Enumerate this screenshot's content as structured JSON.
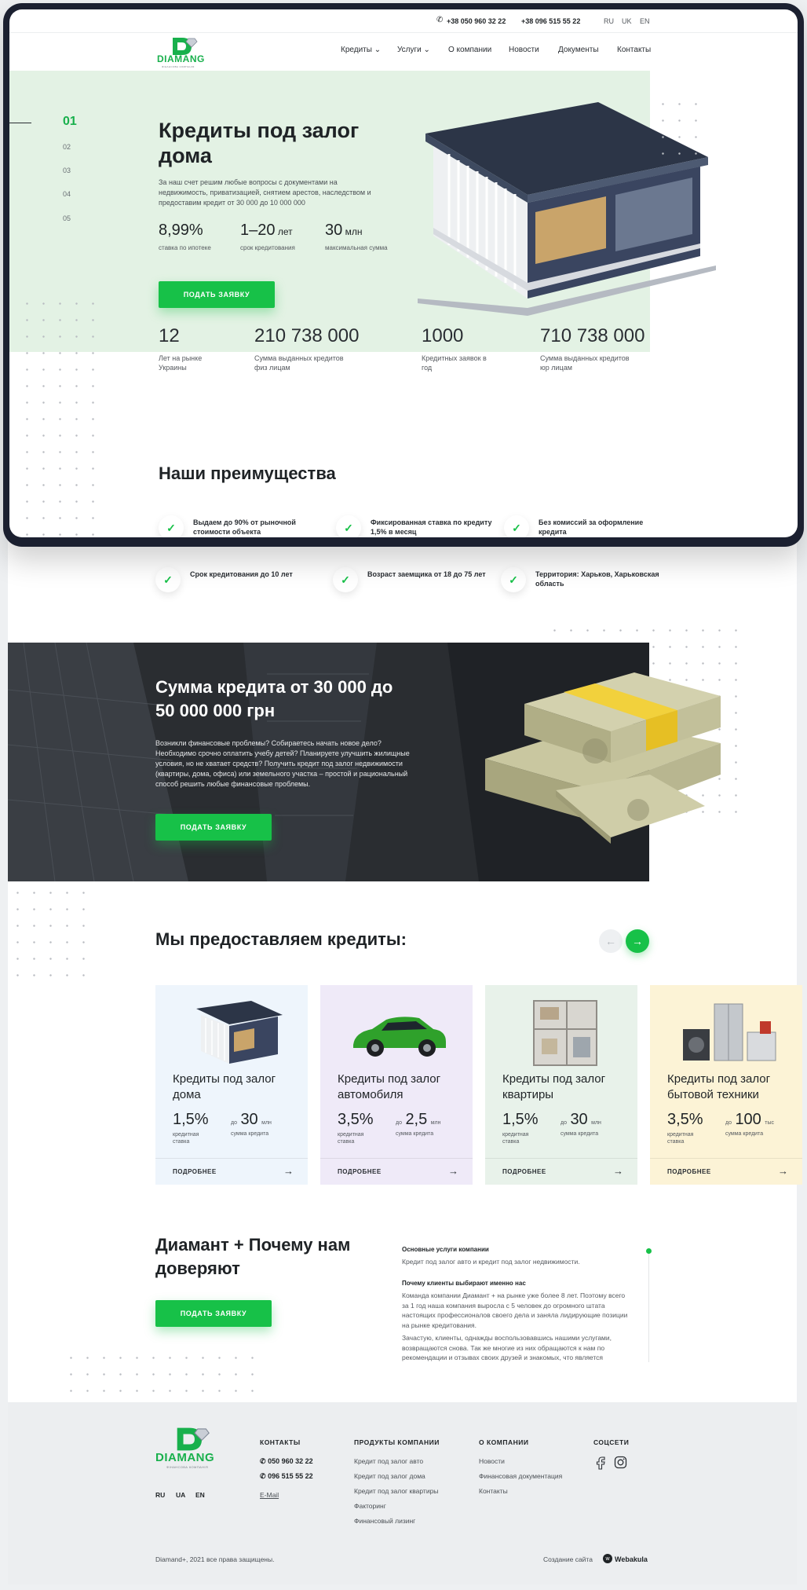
{
  "topbar": {
    "phone1": "+38 050 960 32 22",
    "phone2": "+38 096 515 55 22",
    "langs": [
      "RU",
      "UK",
      "EN"
    ]
  },
  "logo": {
    "word": "DIAMANG",
    "sub": "ФІНАНСОВА КОМПАНІЯ"
  },
  "nav": [
    "Кредиты",
    "Услуги",
    "О компании",
    "Новости",
    "Документы",
    "Контакты"
  ],
  "hero": {
    "slides": [
      "01",
      "02",
      "03",
      "04",
      "05"
    ],
    "title": "Кредиты под залог дома",
    "description": "За наш счет решим любые вопросы с документами на недвижимость, приватизацией, снятием арестов, наследством и предоставим кредит от 30 000 до 10 000 000",
    "stats": [
      {
        "value": "8,99%",
        "unit": "",
        "label": "ставка по ипотеке"
      },
      {
        "value": "1–20",
        "unit": " лет",
        "label": "срок кредитования"
      },
      {
        "value": "30",
        "unit": " млн",
        "label": "максимальная сумма"
      }
    ],
    "button": "ПОДАТЬ ЗАЯВКУ"
  },
  "big_stats": [
    {
      "value": "12",
      "label": "Лет на рынке Украины"
    },
    {
      "value": "210 738 000",
      "label": "Сумма выданных кредитов физ лицам"
    },
    {
      "value": "1000",
      "label": "Кредитных заявок в год"
    },
    {
      "value": "710 738 000",
      "label": "Сумма выданных кредитов юр лицам"
    }
  ],
  "advantages": {
    "title": "Наши преимущества",
    "items": [
      "Выдаем до 90% от рыночной стоимости объекта",
      "Фиксированная ставка по кредиту 1,5% в месяц",
      "Без комиссий за оформление кредита",
      "Срок кредитования до 10 лет",
      "Возраст заемщика от 18 до 75 лет",
      "Территория: Харьков, Харьковская область"
    ]
  },
  "banner": {
    "title": "Сумма кредита от 30 000 до 50 000 000 грн",
    "description": "Возникли финансовые проблемы? Собираетесь начать новое дело? Необходимо срочно оплатить учебу детей? Планируете улучшить жилищные условия, но не хватает средств? Получить кредит под залог недвижимости (квартиры, дома, офиса) или земельного участка – простой и рациональный способ решить любые финансовые проблемы.",
    "button": "ПОДАТЬ ЗАЯВКУ"
  },
  "products": {
    "title": "Мы предоставляем кредиты:",
    "cards": [
      {
        "title": "Кредиты под залог дома",
        "rate": "1,5%",
        "rate_label": "кредитная ставка",
        "sum_prefix": "до",
        "sum": "30",
        "sum_unit": "млн",
        "sum_label": "сумма кредита",
        "more": "ПОДРОБНЕЕ",
        "bg": "#eef5fc"
      },
      {
        "title": "Кредиты под залог автомобиля",
        "rate": "3,5%",
        "rate_label": "кредитная ставка",
        "sum_prefix": "до",
        "sum": "2,5",
        "sum_unit": "млн",
        "sum_label": "сумма кредита",
        "more": "ПОДРОБНЕЕ",
        "bg": "#efeaf8"
      },
      {
        "title": "Кредиты под залог квартиры",
        "rate": "1,5%",
        "rate_label": "кредитная ставка",
        "sum_prefix": "до",
        "sum": "30",
        "sum_unit": "млн",
        "sum_label": "сумма кредита",
        "more": "ПОДРОБНЕЕ",
        "bg": "#e8f2ea"
      },
      {
        "title": "Кредиты под залог бытовой техники",
        "rate": "3,5%",
        "rate_label": "кредитная ставка",
        "sum_prefix": "до",
        "sum": "100",
        "sum_unit": "тыс",
        "sum_label": "сумма кредита",
        "more": "ПОДРОБНЕЕ",
        "bg": "#fcf3d6"
      }
    ]
  },
  "about": {
    "title": "Диамант + Почему нам доверяют",
    "button": "ПОДАТЬ ЗАЯВКУ",
    "h1": "Основные услуги компании",
    "p1": "Кредит под залог авто и кредит под залог недвижимости.",
    "h2": "Почему клиенты выбирают именно нас",
    "p2": "Команда компании Диамант + на рынке уже более 8 лет. Поэтому всего за 1 год наша компания выросла с 5 человек до огромного штата настоящих профессионалов своего дела и заняла лидирующие позиции на рынке кредитования.",
    "p3": "Зачастую, клиенты, однажды воспользовавшись нашими услугами, возвращаются снова. Так же многие из них обращаются к нам по рекомендации и отзывах своих друзей и знакомых, что является"
  },
  "footer": {
    "langs": [
      "RU",
      "UA",
      "EN"
    ],
    "contacts_h": "КОНТАКТЫ",
    "phones": [
      "050 960 32 22",
      "096 515 55 22"
    ],
    "email": "E-Mail",
    "products_h": "ПРОДУКТЫ КОМПАНИИ",
    "products": [
      "Кредит под залог авто",
      "Кредит под залог дома",
      "Кредит под залог квартиры",
      "Факторинг",
      "Финансовый лизинг"
    ],
    "about_h": "О КОМПАНИИ",
    "about": [
      "Новости",
      "Финансовая документация",
      "Контакты"
    ],
    "social_h": "СОЦСЕТИ",
    "copyright": "Diamand+, 2021 все права защищены.",
    "made_by": "Создание сайта",
    "studio": "Webakula"
  },
  "colors": {
    "accent": "#17c148",
    "hero_bg": "#e3f2e4",
    "footer_bg": "#eceef0",
    "frame": "#1b2030"
  }
}
